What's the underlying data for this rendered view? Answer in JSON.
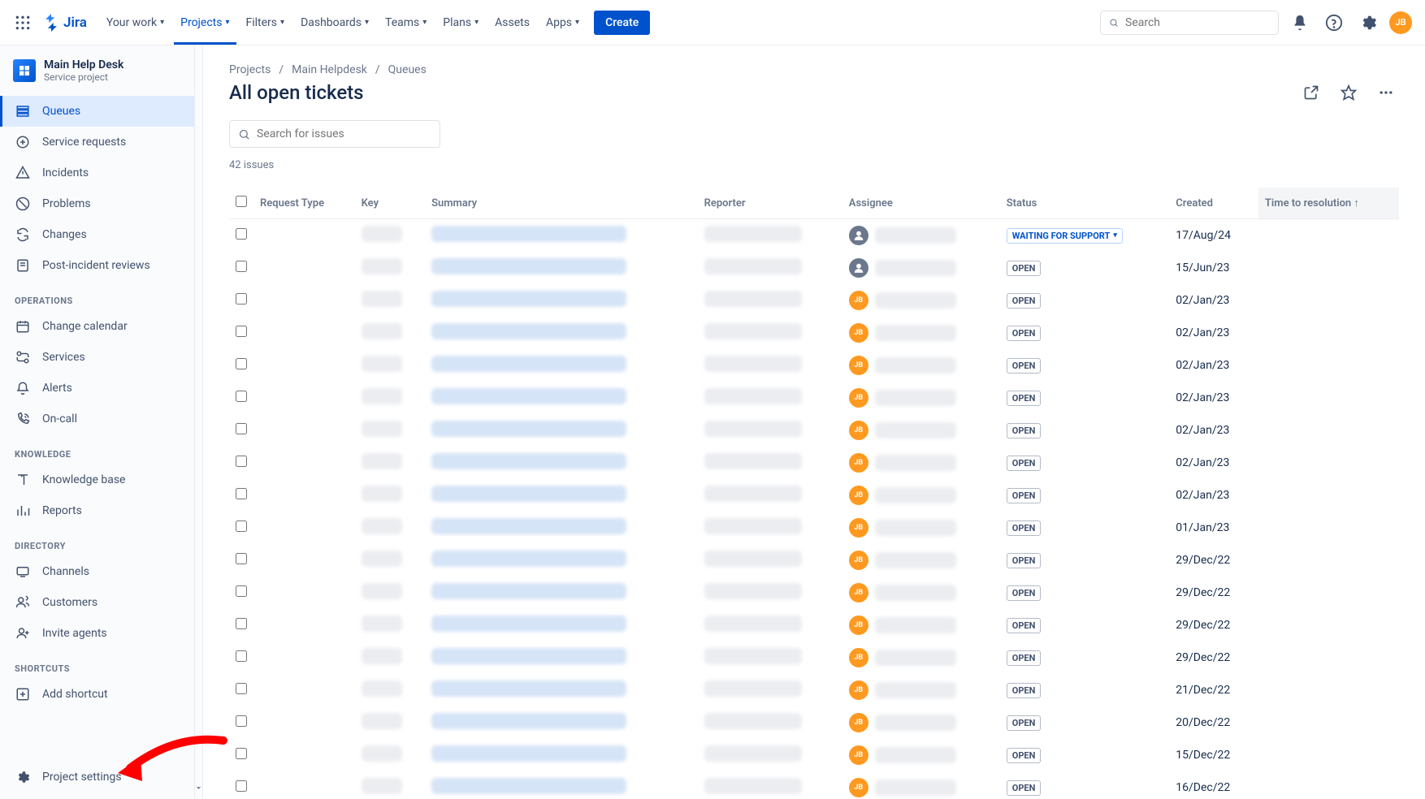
{
  "topnav": {
    "logo": "Jira",
    "items": [
      "Your work",
      "Projects",
      "Filters",
      "Dashboards",
      "Teams",
      "Plans",
      "Assets",
      "Apps"
    ],
    "active_index": 1,
    "create": "Create",
    "search_placeholder": "Search",
    "avatar": "JB"
  },
  "sidebar": {
    "project_title": "Main Help Desk",
    "project_sub": "Service project",
    "main_items": [
      "Queues",
      "Service requests",
      "Incidents",
      "Problems",
      "Changes",
      "Post-incident reviews"
    ],
    "selected_index": 0,
    "sections": {
      "operations": {
        "label": "OPERATIONS",
        "items": [
          "Change calendar",
          "Services",
          "Alerts",
          "On-call"
        ]
      },
      "knowledge": {
        "label": "KNOWLEDGE",
        "items": [
          "Knowledge base",
          "Reports"
        ]
      },
      "directory": {
        "label": "DIRECTORY",
        "items": [
          "Channels",
          "Customers",
          "Invite agents"
        ]
      },
      "shortcuts": {
        "label": "SHORTCUTS",
        "items": [
          "Add shortcut"
        ]
      }
    },
    "project_settings": "Project settings"
  },
  "breadcrumbs": [
    "Projects",
    "Main Helpdesk",
    "Queues"
  ],
  "page_title": "All open tickets",
  "issue_search_placeholder": "Search for issues",
  "count": "42 issues",
  "columns": [
    "",
    "Request Type",
    "Key",
    "Summary",
    "Reporter",
    "Assignee",
    "Status",
    "Created",
    "Time to resolution"
  ],
  "sort_indicator": "↑",
  "statuses": {
    "waiting": "WAITING FOR SUPPORT",
    "open": "OPEN"
  },
  "avatar_initials": "JB",
  "rows": [
    {
      "avatar": "grey",
      "status": "waiting",
      "created": "17/Aug/24"
    },
    {
      "avatar": "grey",
      "status": "open",
      "created": "15/Jun/23"
    },
    {
      "avatar": "jb",
      "status": "open",
      "created": "02/Jan/23"
    },
    {
      "avatar": "jb",
      "status": "open",
      "created": "02/Jan/23"
    },
    {
      "avatar": "jb",
      "status": "open",
      "created": "02/Jan/23"
    },
    {
      "avatar": "jb",
      "status": "open",
      "created": "02/Jan/23"
    },
    {
      "avatar": "jb",
      "status": "open",
      "created": "02/Jan/23"
    },
    {
      "avatar": "jb",
      "status": "open",
      "created": "02/Jan/23"
    },
    {
      "avatar": "jb",
      "status": "open",
      "created": "02/Jan/23"
    },
    {
      "avatar": "jb",
      "status": "open",
      "created": "01/Jan/23"
    },
    {
      "avatar": "jb",
      "status": "open",
      "created": "29/Dec/22"
    },
    {
      "avatar": "jb",
      "status": "open",
      "created": "29/Dec/22"
    },
    {
      "avatar": "jb",
      "status": "open",
      "created": "29/Dec/22"
    },
    {
      "avatar": "jb",
      "status": "open",
      "created": "29/Dec/22"
    },
    {
      "avatar": "jb",
      "status": "open",
      "created": "21/Dec/22"
    },
    {
      "avatar": "jb",
      "status": "open",
      "created": "20/Dec/22"
    },
    {
      "avatar": "jb",
      "status": "open",
      "created": "15/Dec/22"
    },
    {
      "avatar": "jb",
      "status": "open",
      "created": "16/Dec/22"
    }
  ]
}
